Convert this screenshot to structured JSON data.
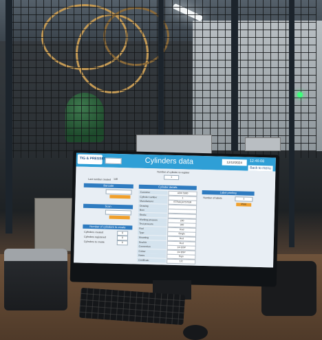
{
  "app": {
    "logo": "TIG & PRESSES",
    "title": "Cylinders data",
    "date": "12/12/2024",
    "time": "12:46:08",
    "back_label": "Back to menu"
  },
  "fields": {
    "number_of_cylinder_label": "Number of cylinder to register",
    "number_of_cylinder_value": "1",
    "last_number_label": "Last number created",
    "last_number_value": "148"
  },
  "left_panel": {
    "section1_header": "Barcode",
    "section2_header": "Scan",
    "section3_header": "Number of cylinders to create",
    "barcode_value": "",
    "scan_value": "",
    "bottom_rows": [
      {
        "label": "Cylinders created",
        "value": "0"
      },
      {
        "label": "Cylinders registered",
        "value": "0"
      },
      {
        "label": "Cylinders to create",
        "value": "0"
      }
    ]
  },
  "middle_panel": {
    "header": "Cylinder details",
    "rows": [
      {
        "label": "Customer",
        "value": "ADR 5000"
      },
      {
        "label": "Cylinder number",
        "value": "1"
      },
      {
        "label": "Manufacturer",
        "value": "STRAIGHTSTER"
      },
      {
        "label": "Drawing",
        "value": ""
      },
      {
        "label": "Bore",
        "value": ""
      },
      {
        "label": "Stroke",
        "value": ""
      },
      {
        "label": "Working pressure",
        "value": "200"
      },
      {
        "label": "Test pressure",
        "value": "300"
      },
      {
        "label": "Rod",
        "value": "Rod"
      },
      {
        "label": "Type",
        "value": "Single"
      },
      {
        "label": "Mounting",
        "value": "Rod"
      },
      {
        "label": "Seal kit",
        "value": "Rod"
      },
      {
        "label": "Connection",
        "value": "1/4 BSP"
      },
      {
        "label": "Colour",
        "value": "1/4 BSP"
      },
      {
        "label": "Notes",
        "value": "Sign"
      },
      {
        "label": "Certificate",
        "value": "1/2"
      }
    ]
  },
  "right_panel": {
    "header": "Label printing",
    "row_label": "Number of labels",
    "row_value": "1",
    "print_label": "Print"
  },
  "colors": {
    "accent": "#2f9fd6",
    "header_blue": "#2e7bc0",
    "button_orange": "#f0a02c"
  }
}
